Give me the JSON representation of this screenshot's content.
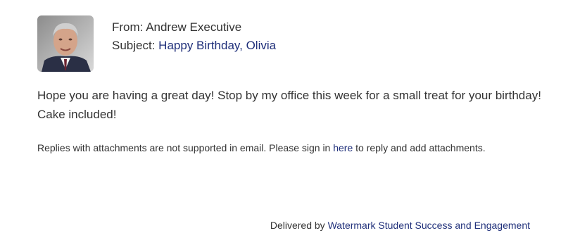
{
  "email": {
    "from_label": "From:",
    "from_name": "Andrew Executive",
    "subject_label": "Subject:",
    "subject": "Happy Birthday, Olivia",
    "message": "Hope you are having a great day! Stop by my office this week for a small treat for your birthday! Cake included!",
    "note": {
      "before_link": "Replies with attachments are not supported in email. Please sign in",
      "link_text": "here",
      "after_link": "to reply and add attachments."
    },
    "footer": {
      "prefix": "Delivered by",
      "link_text": "Watermark Student Success and Engagement"
    }
  },
  "colors": {
    "link": "#1f2f7a",
    "text": "#333333"
  },
  "icons": {
    "avatar": "sender-photo"
  }
}
